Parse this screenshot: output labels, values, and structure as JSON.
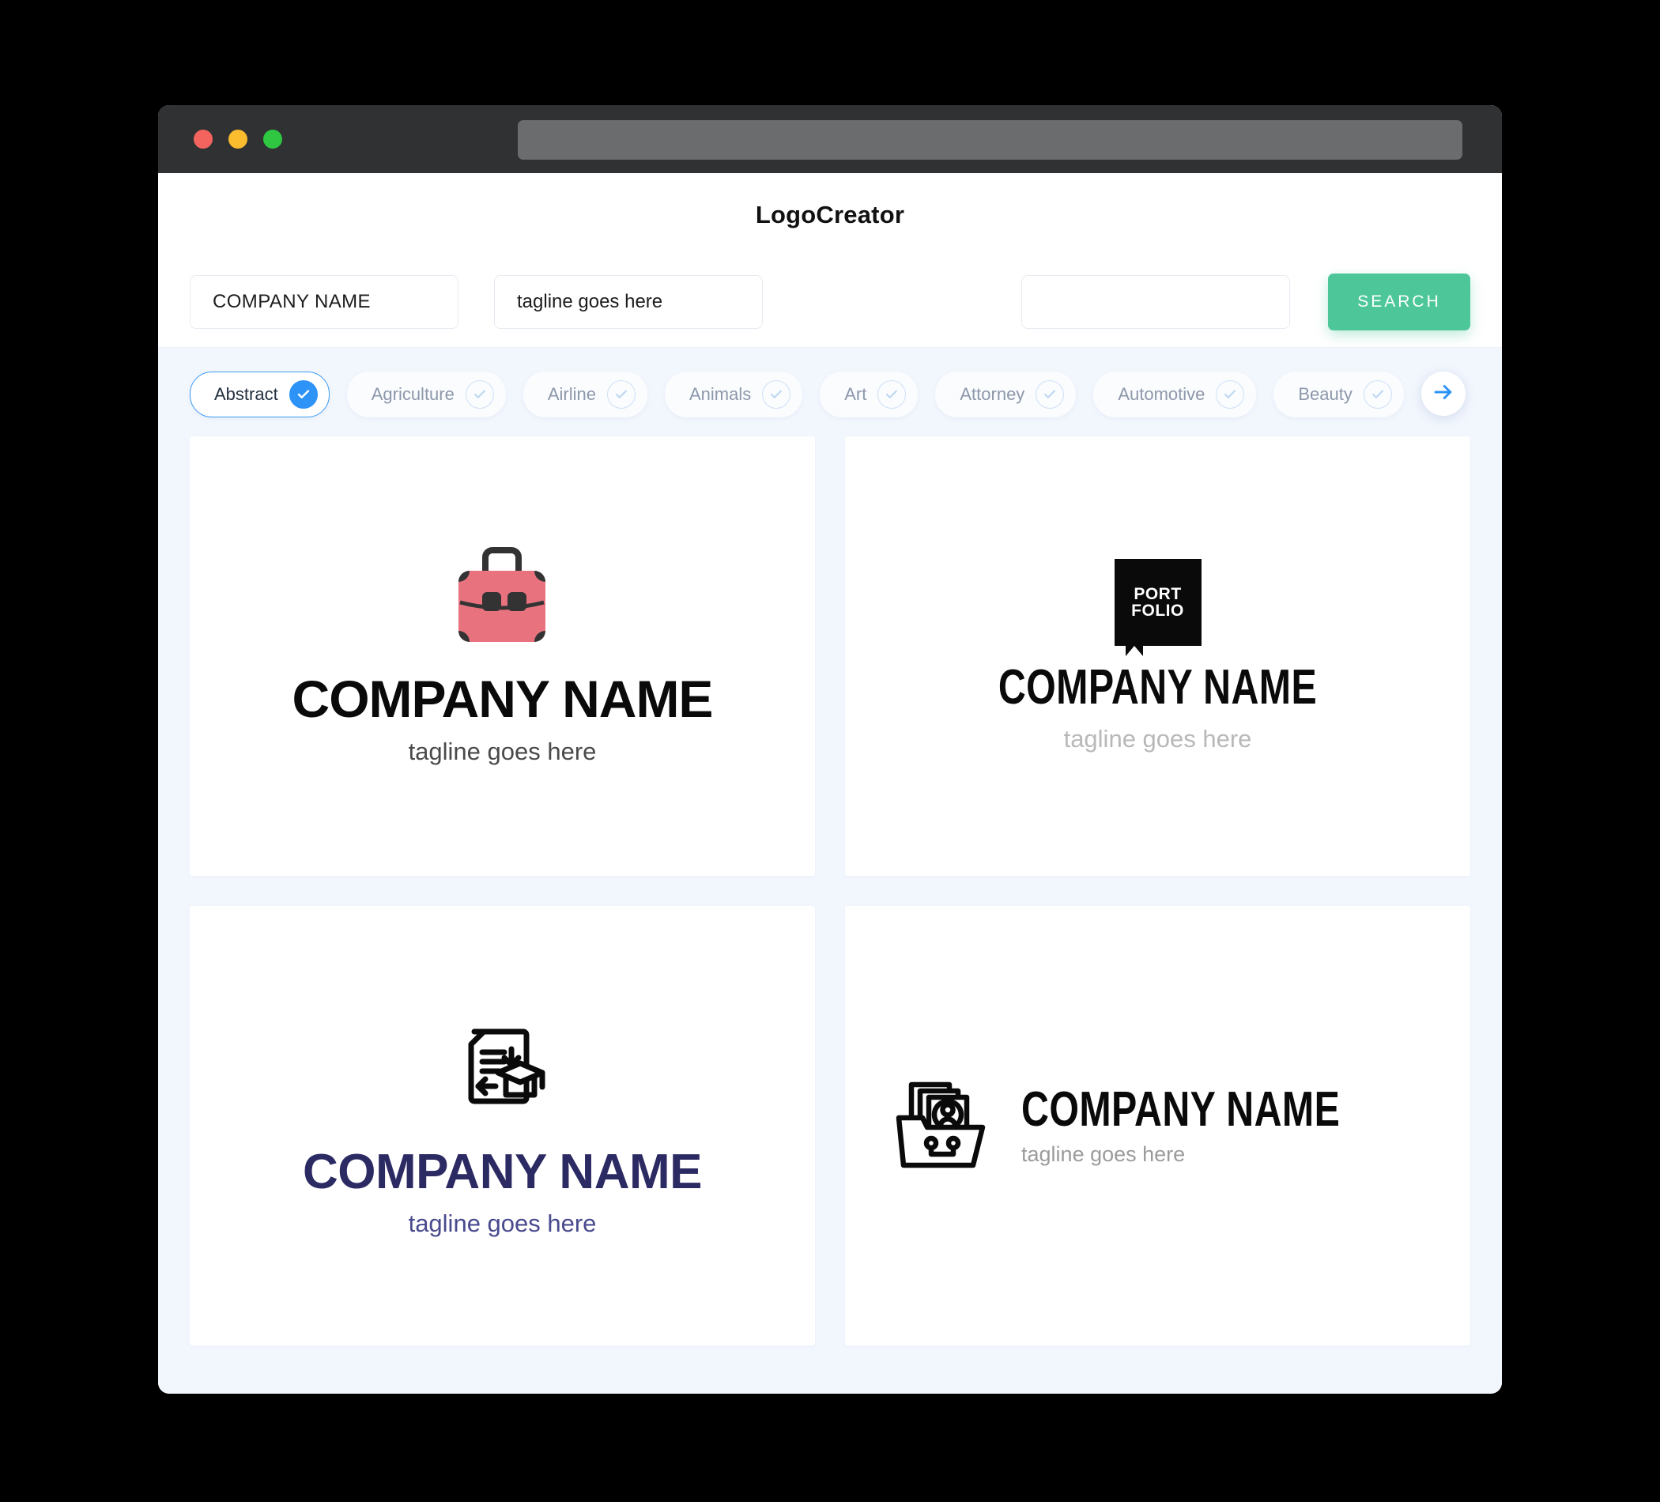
{
  "window": {
    "traffic_lights": [
      "close",
      "minimize",
      "maximize"
    ],
    "url_value": ""
  },
  "header": {
    "title": "LogoCreator"
  },
  "search": {
    "company_value": "COMPANY NAME",
    "company_placeholder": "COMPANY NAME",
    "tagline_value": "tagline goes here",
    "tagline_placeholder": "tagline goes here",
    "extra_value": "",
    "extra_placeholder": "",
    "button_label": "SEARCH"
  },
  "categories": {
    "next_icon": "arrow-right-icon",
    "items": [
      {
        "label": "Abstract",
        "selected": true
      },
      {
        "label": "Agriculture",
        "selected": false
      },
      {
        "label": "Airline",
        "selected": false
      },
      {
        "label": "Animals",
        "selected": false
      },
      {
        "label": "Art",
        "selected": false
      },
      {
        "label": "Attorney",
        "selected": false
      },
      {
        "label": "Automotive",
        "selected": false
      },
      {
        "label": "Beauty",
        "selected": false
      }
    ]
  },
  "results": [
    {
      "icon": "briefcase-icon",
      "name": "COMPANY NAME",
      "tagline": "tagline goes here",
      "name_color": "#0a0a0a",
      "tagline_color": "#4a4a4a",
      "accent_color": "#e8737f"
    },
    {
      "icon": "portfolio-bookmark-icon",
      "badge_line1": "PORT",
      "badge_line2": "FOLIO",
      "name": "COMPANY NAME",
      "tagline": "tagline goes here",
      "name_color": "#0a0a0a",
      "tagline_color": "#b8b8b8",
      "accent_color": "#0a0a0a"
    },
    {
      "icon": "document-graduation-cap-icon",
      "name": "COMPANY NAME",
      "tagline": "tagline goes here",
      "name_color": "#2c2a63",
      "tagline_color": "#4a4a8f",
      "accent_color": "#0a0a0a"
    },
    {
      "icon": "folder-documents-person-icon",
      "name": "COMPANY NAME",
      "tagline": "tagline goes here",
      "name_color": "#0a0a0a",
      "tagline_color": "#9b9b9b",
      "accent_color": "#0a0a0a"
    }
  ],
  "colors": {
    "page_background": "#000000",
    "app_background": "#f2f6fd",
    "card_background": "#ffffff",
    "search_button": "#4dc79a",
    "chip_selected_border": "#3d9bf5",
    "chip_check_active": "#2e93f7",
    "titlebar": "#2f3133"
  }
}
